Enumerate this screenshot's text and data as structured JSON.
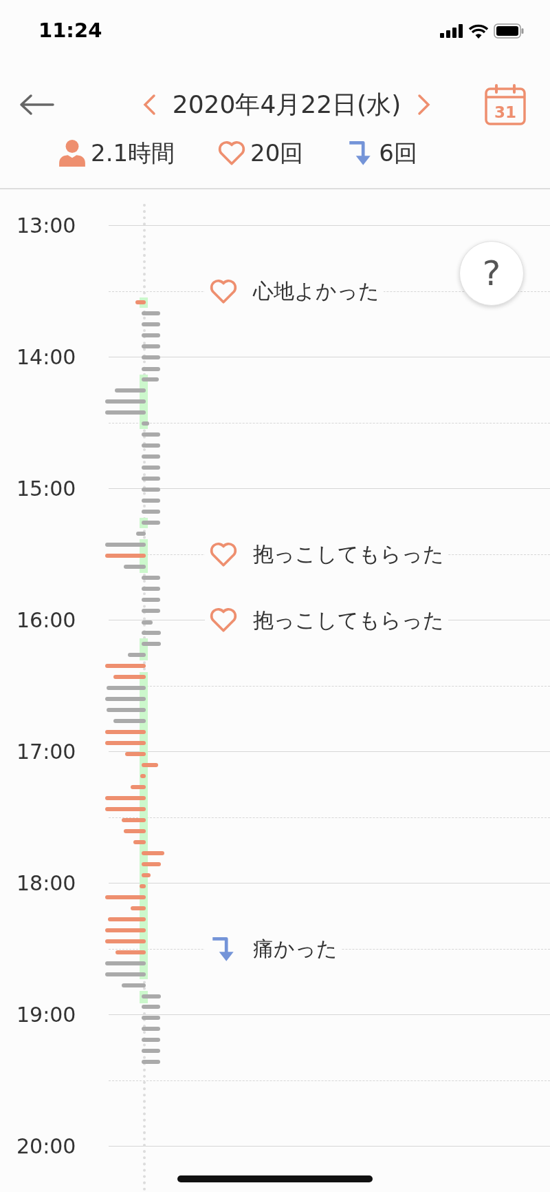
{
  "status_bar": {
    "time": "11:24"
  },
  "header": {
    "date": "2020年4月22日(水)",
    "calendar_day": "31"
  },
  "summary": [
    {
      "kind": "person",
      "text": "2.1時間"
    },
    {
      "kind": "heart",
      "text": "20回"
    },
    {
      "kind": "pain",
      "text": "6回"
    }
  ],
  "timeline": {
    "slots": [
      {
        "kind": "hour",
        "label": "13:00"
      },
      {
        "kind": "half",
        "events": [
          {
            "kind": "heart",
            "text": "心地よかった"
          }
        ]
      },
      {
        "kind": "hour",
        "label": "14:00"
      },
      {
        "kind": "half"
      },
      {
        "kind": "hour",
        "label": "15:00"
      },
      {
        "kind": "half",
        "events": [
          {
            "kind": "heart",
            "text": "抱っこしてもらった"
          }
        ]
      },
      {
        "kind": "hour",
        "label": "16:00",
        "events": [
          {
            "kind": "heart",
            "text": "抱っこしてもらった"
          }
        ]
      },
      {
        "kind": "half"
      },
      {
        "kind": "hour",
        "label": "17:00"
      },
      {
        "kind": "half"
      },
      {
        "kind": "hour",
        "label": "18:00"
      },
      {
        "kind": "half",
        "events": [
          {
            "kind": "pain",
            "text": "痛かった"
          }
        ]
      },
      {
        "kind": "hour",
        "label": "19:00"
      },
      {
        "kind": "half"
      },
      {
        "kind": "hour",
        "label": "20:00"
      }
    ]
  },
  "help_button": {
    "label": "?"
  }
}
